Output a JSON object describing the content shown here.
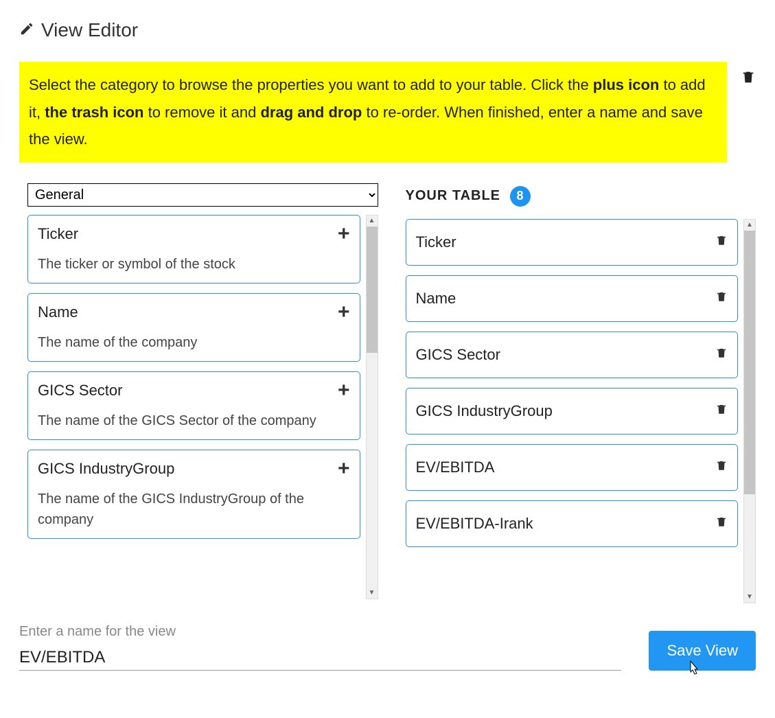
{
  "header": {
    "title": "View Editor"
  },
  "instructions": {
    "part1": "Select the category to browse the properties you want to add to your table. Click the ",
    "bold1": "plus icon",
    "part2": " to add it, ",
    "bold2": "the trash icon",
    "part3": " to remove it and ",
    "bold3": "drag and drop",
    "part4": " to re-order. When finished, enter a name and save the view."
  },
  "category": {
    "selected": "General"
  },
  "properties": [
    {
      "name": "Ticker",
      "desc": "The ticker or symbol of the stock"
    },
    {
      "name": "Name",
      "desc": "The name of the company"
    },
    {
      "name": "GICS Sector",
      "desc": "The name of the GICS Sector of the company"
    },
    {
      "name": "GICS IndustryGroup",
      "desc": "The name of the GICS IndustryGroup of the company"
    }
  ],
  "your_table": {
    "label": "YOUR TABLE",
    "count": "8",
    "items": [
      {
        "name": "Ticker"
      },
      {
        "name": "Name"
      },
      {
        "name": "GICS Sector"
      },
      {
        "name": "GICS IndustryGroup"
      },
      {
        "name": "EV/EBITDA"
      },
      {
        "name": "EV/EBITDA-Irank"
      }
    ]
  },
  "footer": {
    "name_label": "Enter a name for the view",
    "name_value": "EV/EBITDA",
    "save_label": "Save View"
  }
}
